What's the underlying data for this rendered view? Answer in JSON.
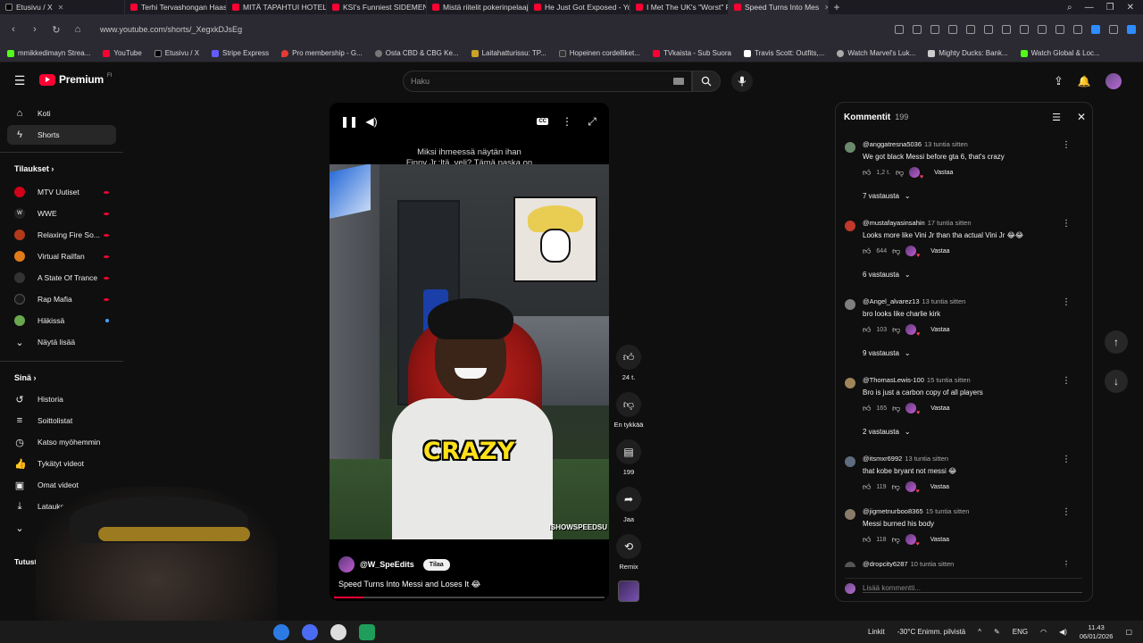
{
  "browser": {
    "tabs": [
      {
        "label": "Etusivu / X",
        "favicon": "x-icon"
      },
      {
        "label": "Terhi Tervashongan Haast",
        "favicon": "youtube-icon"
      },
      {
        "label": "MITÄ TAPAHTUI HOTELLI",
        "favicon": "youtube-icon"
      },
      {
        "label": "KSI's Funniest SIDEMEN M",
        "favicon": "youtube-icon"
      },
      {
        "label": "Mistä riitelit pokerinpelaaj",
        "favicon": "youtube-icon"
      },
      {
        "label": "He Just Got Exposed - You",
        "favicon": "youtube-icon"
      },
      {
        "label": "I Met The UK's \"Worst\" Pr",
        "favicon": "youtube-icon"
      },
      {
        "label": "Speed Turns Into Mes",
        "favicon": "youtube-icon"
      }
    ],
    "url": "www.youtube.com/shorts/_XegxkDJsEg",
    "bookmarks": [
      "mmikkedimayn Strea...",
      "YouTube",
      "Etusivu / X",
      "Stripe Express",
      "Pro membership - G...",
      "Osta CBD & CBG Ke...",
      "Laitahatturissu: TP...",
      "Hopeinen cordelliket...",
      "TVkaista - Sub Suora",
      "Travis Scott: Outfits,...",
      "Watch Marvel's Luk...",
      "Mighty Ducks: Bank...",
      "Watch Global & Loc..."
    ]
  },
  "masthead": {
    "logo_text": "Premium",
    "logo_region": "FI",
    "search_placeholder": "Haku"
  },
  "sidebar": {
    "main": [
      {
        "label": "Koti",
        "icon": "home-icon"
      },
      {
        "label": "Shorts",
        "icon": "shorts-icon"
      }
    ],
    "subscriptions_heading": "Tilaukset",
    "subscriptions": [
      {
        "label": "MTV Uutiset",
        "color": "#d0021b"
      },
      {
        "label": "WWE",
        "color": "#222222"
      },
      {
        "label": "Relaxing Fire So...",
        "color": "#b23a1a"
      },
      {
        "label": "Virtual Railfan",
        "color": "#e07b1a"
      },
      {
        "label": "A State Of Trance",
        "color": "#333333"
      },
      {
        "label": "Rap Mafia",
        "color": "#1a1a1a"
      },
      {
        "label": "Häkissä",
        "color": "#6aa84f"
      },
      {
        "label": "Näytä lisää",
        "icon": "chevron-down-icon"
      }
    ],
    "you_heading": "Sinä",
    "you": [
      {
        "label": "Historia",
        "icon": "history-icon"
      },
      {
        "label": "Soittolistat",
        "icon": "playlist-icon"
      },
      {
        "label": "Katso myöhemmin",
        "icon": "clock-icon"
      },
      {
        "label": "Tykätyt videot",
        "icon": "thumb-up-icon"
      },
      {
        "label": "Omat videot",
        "icon": "video-icon"
      },
      {
        "label": "Lataukset",
        "icon": "download-icon"
      }
    ],
    "explore_heading": "Tutust"
  },
  "player": {
    "caption_line1": "Miksi ihmeessä näytän ihan",
    "caption_line2": "Finny Jr.:ltä, veli? Tämä paska on",
    "overlay_text": "CRAZY",
    "watermark": "ISHOWSPEEDSU",
    "channel": "@W_SpeEdits",
    "subscribe_label": "Tilaa",
    "title": "Speed Turns Into Messi and Loses It 😂",
    "progress_fraction": 0.11
  },
  "actions": {
    "like_count": "24 t.",
    "dislike_label": "En tykkää",
    "comment_count": "199",
    "share_label": "Jaa",
    "remix_label": "Remix"
  },
  "comments": {
    "title": "Kommentit",
    "count": "199",
    "input_placeholder": "Lisää kommentti...",
    "reply_label": "Vastaa",
    "items": [
      {
        "handle": "@anggatresna5036",
        "time": "13 tuntia sitten",
        "text": "We got black Messi before gta 6, that's crazy",
        "likes": "1,2 t.",
        "replies": "7 vastausta",
        "avatar_color": "#6b8a6b"
      },
      {
        "handle": "@mustafayasinsahin",
        "time": "17 tuntia sitten",
        "text": "Looks more like Vini Jr than tha actual Vini Jr 😂😂",
        "likes": "644",
        "replies": "6 vastausta",
        "avatar_color": "#c0392b"
      },
      {
        "handle": "@Angel_alvarez13",
        "time": "13 tuntia sitten",
        "text": "bro looks like charlie kirk",
        "likes": "103",
        "replies": "9 vastausta",
        "avatar_color": "#7f7f7f"
      },
      {
        "handle": "@ThomasLewis-100",
        "time": "15 tuntia sitten",
        "text": "Bro is just a carbon copy of all players",
        "likes": "165",
        "replies": "2 vastausta",
        "avatar_color": "#a0855b"
      },
      {
        "handle": "@itsmxr6992",
        "time": "13 tuntia sitten",
        "text": "that kobe bryant not messi 😂",
        "likes": "119",
        "replies": "",
        "avatar_color": "#5d6d7e"
      },
      {
        "handle": "@jigmetnurboo8365",
        "time": "15 tuntia sitten",
        "text": "Messi burned his body",
        "likes": "118",
        "replies": "",
        "avatar_color": "#8a7a6a"
      },
      {
        "handle": "@dropcity6287",
        "time": "10 tuntia sitten",
        "text": "",
        "likes": "",
        "replies": "",
        "avatar_color": "#555555"
      }
    ]
  },
  "taskbar": {
    "links_label": "Linkit",
    "weather": "-30°C  Enimm. pilvistä",
    "language": "ENG",
    "time": "11.43",
    "date": "06/01/2026"
  },
  "colors": {
    "accent_red": "#ff0033",
    "background": "#0f0f0f",
    "caption_yellow": "#ffe11a"
  }
}
